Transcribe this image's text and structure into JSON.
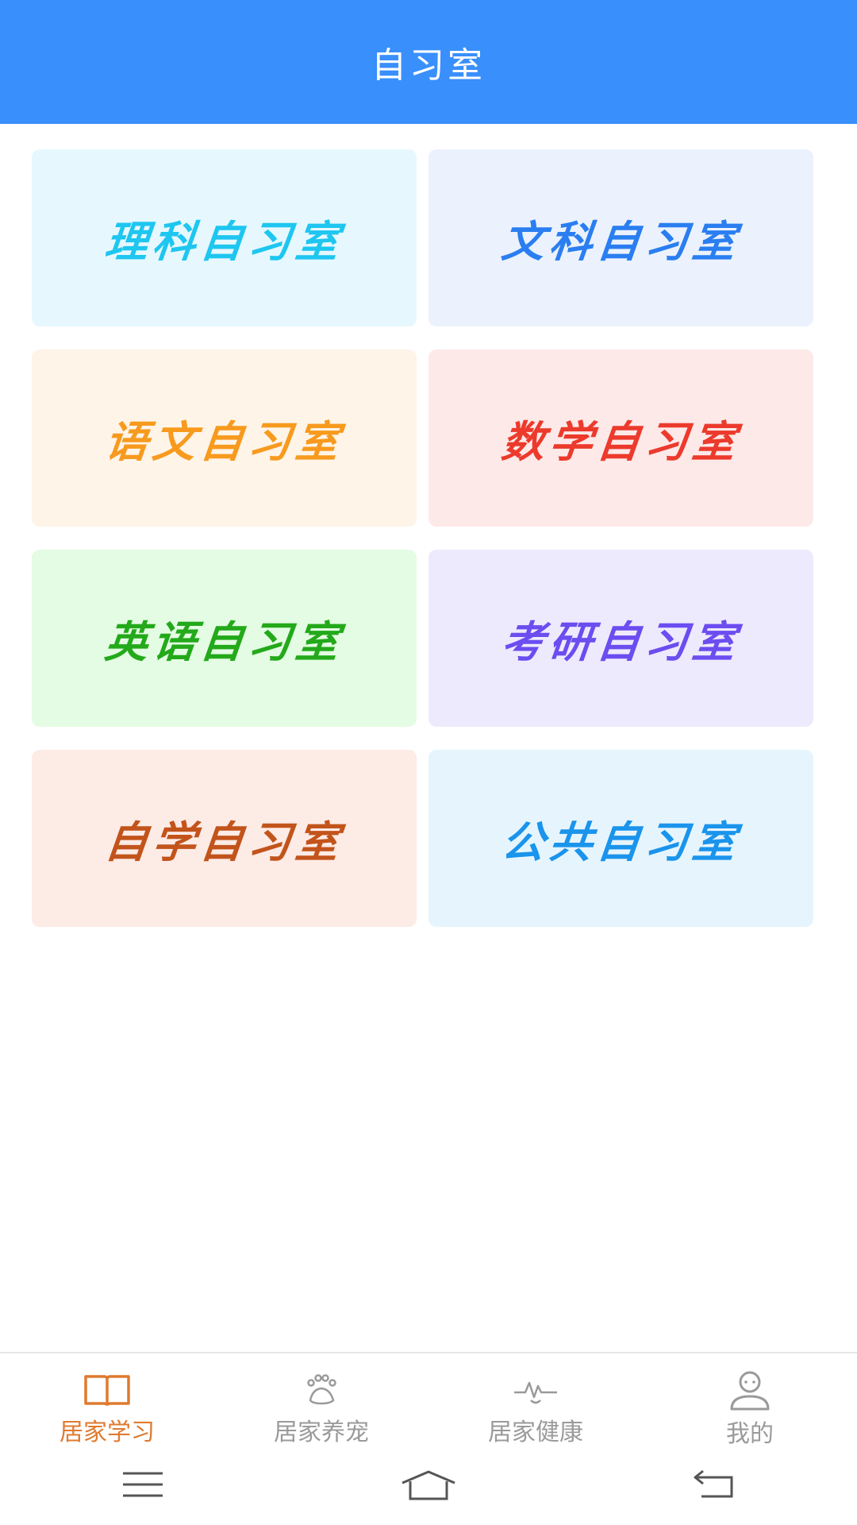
{
  "header": {
    "title": "自习室"
  },
  "rooms": [
    {
      "label": "理科自习室",
      "color": "#1ec6f0",
      "bg": "#e6f8fe"
    },
    {
      "label": "文科自习室",
      "color": "#2a7ef0",
      "bg": "#ebf2fd"
    },
    {
      "label": "语文自习室",
      "color": "#f79a1e",
      "bg": "#fef4e8"
    },
    {
      "label": "数学自习室",
      "color": "#ec3a2c",
      "bg": "#fde9e8"
    },
    {
      "label": "英语自习室",
      "color": "#23a91a",
      "bg": "#e4fce3"
    },
    {
      "label": "考研自习室",
      "color": "#6b4df0",
      "bg": "#eeeafd"
    },
    {
      "label": "自学自习室",
      "color": "#c2541b",
      "bg": "#fdebe6"
    },
    {
      "label": "公共自习室",
      "color": "#1a94ec",
      "bg": "#e6f5fd"
    }
  ],
  "bottom_nav": {
    "items": [
      {
        "label": "居家学习",
        "icon": "open-book-icon",
        "active": true
      },
      {
        "label": "居家养宠",
        "icon": "paw-icon",
        "active": false
      },
      {
        "label": "居家健康",
        "icon": "heartbeat-icon",
        "active": false
      },
      {
        "label": "我的",
        "icon": "user-icon",
        "active": false
      }
    ],
    "active_color": "#e07a2f",
    "inactive_color": "#9a9a9a"
  },
  "system_nav": {
    "icons": [
      "menu-icon",
      "home-icon",
      "back-icon"
    ]
  },
  "colors": {
    "header_bg": "#398ffb"
  }
}
